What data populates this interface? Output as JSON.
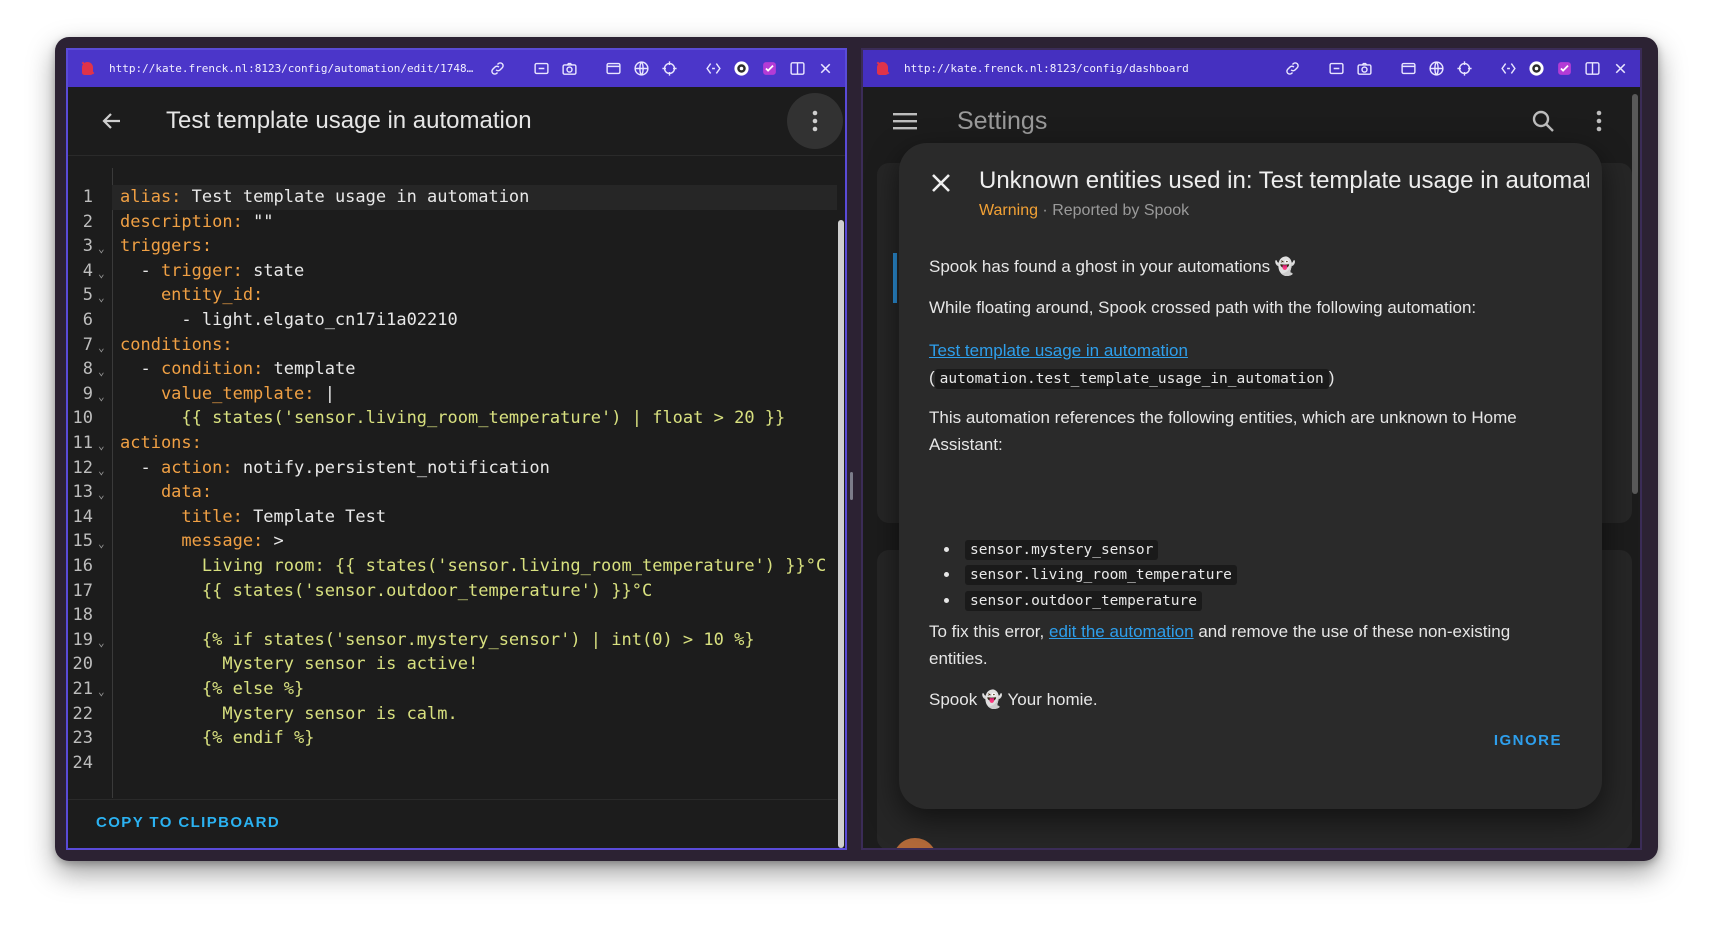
{
  "left_pane": {
    "url": "http://kate.frenck.nl:8123/config/automation/edit/1748…",
    "title": "Test template usage in automation",
    "copy_label": "COPY TO CLIPBOARD",
    "code_lines": [
      {
        "n": "1",
        "fold": "",
        "parts": [
          {
            "t": "alias: ",
            "c": "k"
          },
          {
            "t": "Test template usage in automation",
            "c": ""
          }
        ]
      },
      {
        "n": "2",
        "fold": "",
        "parts": [
          {
            "t": "description: ",
            "c": "k"
          },
          {
            "t": "\"\"",
            "c": ""
          }
        ]
      },
      {
        "n": "3",
        "fold": "⌄",
        "parts": [
          {
            "t": "triggers:",
            "c": "k"
          }
        ]
      },
      {
        "n": "4",
        "fold": "⌄",
        "parts": [
          {
            "t": "  - ",
            "c": ""
          },
          {
            "t": "trigger: ",
            "c": "k"
          },
          {
            "t": "state",
            "c": ""
          }
        ]
      },
      {
        "n": "5",
        "fold": "⌄",
        "parts": [
          {
            "t": "    entity_id:",
            "c": "k"
          }
        ]
      },
      {
        "n": "6",
        "fold": "",
        "parts": [
          {
            "t": "      - light.elgato_cn17i1a02210",
            "c": ""
          }
        ]
      },
      {
        "n": "7",
        "fold": "⌄",
        "parts": [
          {
            "t": "conditions:",
            "c": "k"
          }
        ]
      },
      {
        "n": "8",
        "fold": "⌄",
        "parts": [
          {
            "t": "  - ",
            "c": ""
          },
          {
            "t": "condition: ",
            "c": "k"
          },
          {
            "t": "template",
            "c": ""
          }
        ]
      },
      {
        "n": "9",
        "fold": "⌄",
        "parts": [
          {
            "t": "    value_template: ",
            "c": "k"
          },
          {
            "t": "|",
            "c": ""
          }
        ]
      },
      {
        "n": "10",
        "fold": "",
        "parts": [
          {
            "t": "      {{ states('sensor.living_room_temperature') | float > 20 }}",
            "c": "s"
          }
        ]
      },
      {
        "n": "11",
        "fold": "⌄",
        "parts": [
          {
            "t": "actions:",
            "c": "k"
          }
        ]
      },
      {
        "n": "12",
        "fold": "⌄",
        "parts": [
          {
            "t": "  - ",
            "c": ""
          },
          {
            "t": "action: ",
            "c": "k"
          },
          {
            "t": "notify.persistent_notification",
            "c": ""
          }
        ]
      },
      {
        "n": "13",
        "fold": "⌄",
        "parts": [
          {
            "t": "    data:",
            "c": "k"
          }
        ]
      },
      {
        "n": "14",
        "fold": "",
        "parts": [
          {
            "t": "      title: ",
            "c": "k"
          },
          {
            "t": "Template Test",
            "c": ""
          }
        ]
      },
      {
        "n": "15",
        "fold": "⌄",
        "parts": [
          {
            "t": "      message: ",
            "c": "k"
          },
          {
            "t": ">",
            "c": ""
          }
        ]
      },
      {
        "n": "16",
        "fold": "",
        "parts": [
          {
            "t": "        Living room: {{ states('sensor.living_room_temperature') }}°C",
            "c": "s"
          }
        ]
      },
      {
        "n": "17",
        "fold": "",
        "parts": [
          {
            "t": "        {{ states('sensor.outdoor_temperature') }}°C",
            "c": "s"
          }
        ]
      },
      {
        "n": "18",
        "fold": "",
        "parts": [
          {
            "t": "",
            "c": ""
          }
        ]
      },
      {
        "n": "19",
        "fold": "⌄",
        "parts": [
          {
            "t": "        {% if states('sensor.mystery_sensor') | int(0) > 10 %}",
            "c": "s"
          }
        ]
      },
      {
        "n": "20",
        "fold": "",
        "parts": [
          {
            "t": "          Mystery sensor is active!",
            "c": "s"
          }
        ]
      },
      {
        "n": "21",
        "fold": "⌄",
        "parts": [
          {
            "t": "        {% else %}",
            "c": "s"
          }
        ]
      },
      {
        "n": "22",
        "fold": "",
        "parts": [
          {
            "t": "          Mystery sensor is calm.",
            "c": "s"
          }
        ]
      },
      {
        "n": "23",
        "fold": "",
        "parts": [
          {
            "t": "        {% endif %}",
            "c": "s"
          }
        ]
      },
      {
        "n": "24",
        "fold": "",
        "parts": [
          {
            "t": "",
            "c": ""
          }
        ]
      }
    ]
  },
  "right_pane": {
    "url": "http://kate.frenck.nl:8123/config/dashboard",
    "title": "Settings",
    "dialog": {
      "title": "Unknown entities used in: Test template usage in automation",
      "severity": "Warning",
      "separator": " · ",
      "reporter": "Reported by Spook",
      "p1": "Spook has found a ghost in your automations 👻",
      "p2": "While floating around, Spook crossed path with the following automation:",
      "automation_link": "Test template usage in automation",
      "automation_id_open": "(",
      "automation_id": "automation.test_template_usage_in_automation",
      "automation_id_close": ")",
      "p3": "This automation references the following entities, which are unknown to Home Assistant:",
      "entities": [
        "sensor.mystery_sensor",
        "sensor.living_room_temperature",
        "sensor.outdoor_temperature"
      ],
      "fix_pre": "To fix this error, ",
      "fix_link": "edit the automation",
      "fix_post": " and remove the use of these non-existing entities.",
      "sign": "Spook 👻 Your homie.",
      "ignore_label": "IGNORE"
    }
  },
  "colors": {
    "toolbar": "#4b36c9",
    "accent": "#2bb2f2",
    "warning": "#f2a135",
    "yaml_key": "#f0a044",
    "yaml_template": "#d8e07f"
  }
}
